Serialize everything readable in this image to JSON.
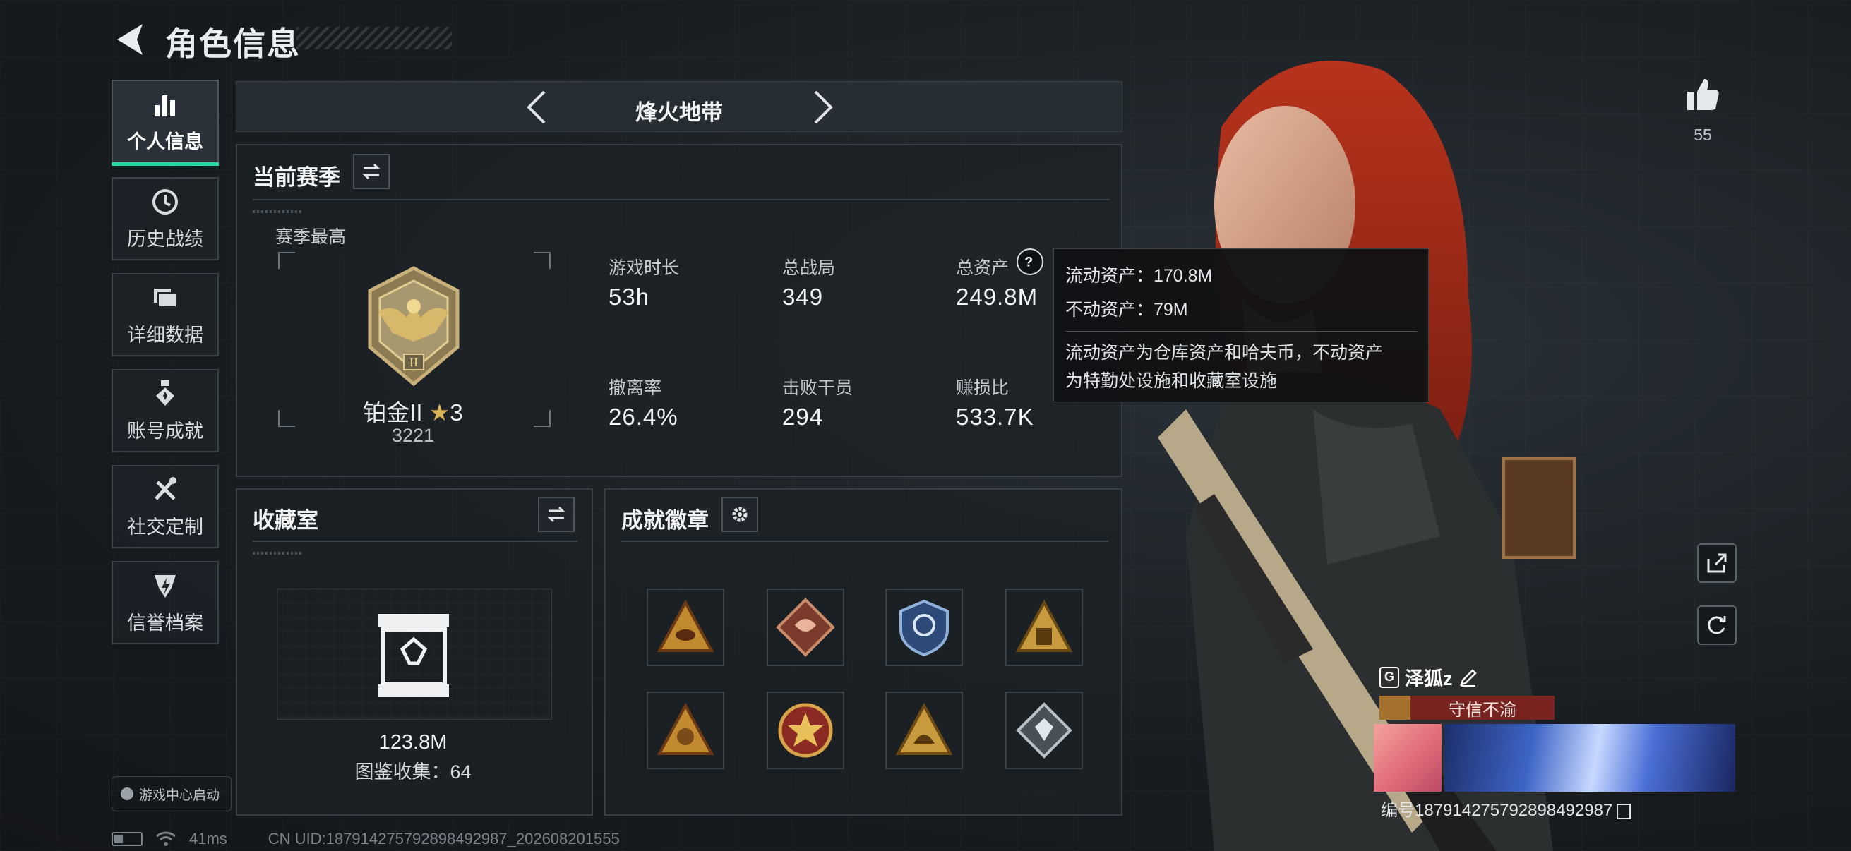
{
  "header": {
    "title": "角色信息"
  },
  "sidebar": {
    "items": [
      {
        "label": "个人信息",
        "icon": "bar-chart-icon",
        "active": true
      },
      {
        "label": "历史战绩",
        "icon": "history-icon"
      },
      {
        "label": "详细数据",
        "icon": "folder-icon"
      },
      {
        "label": "账号成就",
        "icon": "medal-icon"
      },
      {
        "label": "社交定制",
        "icon": "tools-icon"
      },
      {
        "label": "信誉档案",
        "icon": "shield-icon"
      }
    ],
    "game_center": "游戏中心启动"
  },
  "mode_selector": {
    "title": "烽火地带"
  },
  "season": {
    "title": "当前赛季",
    "best_label": "赛季最高",
    "rank_name": "铂金II",
    "rank_star": "★",
    "rank_stars": "3",
    "rank_score": "3221",
    "stats": [
      {
        "label": "游戏时长",
        "value": "53h"
      },
      {
        "label": "总战局",
        "value": "349"
      },
      {
        "label": "总资产",
        "value": "249.8M"
      },
      {
        "label": "撤离率",
        "value": "26.4%"
      },
      {
        "label": "击败干员",
        "value": "294"
      },
      {
        "label": "赚损比",
        "value": "533.7K"
      }
    ]
  },
  "tooltip": {
    "liquid": "流动资产：170.8M",
    "fixed": "不动资产：79M",
    "desc_line1": "流动资产为仓库资产和哈夫币，不动资产",
    "desc_line2": "为特勤处设施和收藏室设施"
  },
  "collection": {
    "title": "收藏室",
    "value": "123.8M",
    "count": "图鉴收集：64"
  },
  "badges": {
    "title": "成就徽章",
    "items": [
      "triangle-fish-badge",
      "dragon-diamond-badge",
      "shield-crest-badge",
      "triangle-figures-badge",
      "triangle-55-badge",
      "star-emblem-badge",
      "triangle-helmet-badge",
      "diamond-gem-badge"
    ]
  },
  "right": {
    "likes": "55",
    "player_name": "泽狐z",
    "name_badge": "G",
    "reputation": "守信不渝",
    "player_id": "编号1879142757928984929​87"
  },
  "footer": {
    "ping": "41ms",
    "uid": "CN UID:187914275792898492987_202608201555"
  },
  "colors": {
    "accent": "#2fd3a5",
    "gold": "#d9b35a",
    "rep_red": "#7a2422"
  }
}
